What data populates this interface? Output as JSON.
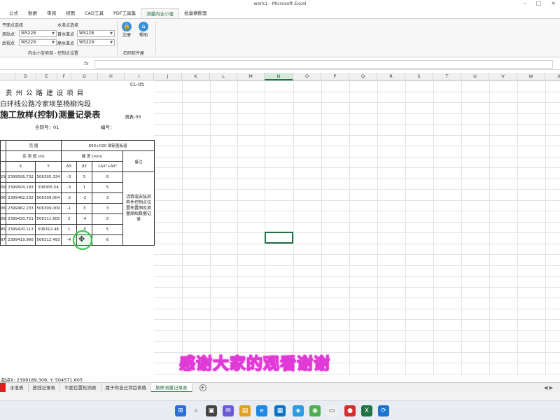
{
  "window": {
    "title": "work1 - Microsoft Excel"
  },
  "ribbon": {
    "tabs": [
      "公式",
      "数据",
      "审阅",
      "视图",
      "CAD工具",
      "PDF工具集",
      "测量内业小宝",
      "批量横断面"
    ],
    "active_tab": "测量内业小宝",
    "plane_group_title": "平面点选择",
    "level_group_title": "水准点选择",
    "station_label": "测站点",
    "station_value": "WS228",
    "backsight_label": "后视点",
    "backsight_value": "WS229",
    "bm_start_label": "首水准点",
    "bm_start_value": "WS228",
    "bm_end_label": "尾水准点",
    "bm_end_value": "WS229",
    "group1_footer": "内业小宝项目 - 控制点设置",
    "register_label": "注册",
    "help_label": "帮助",
    "group2_footer": "石码软件屋"
  },
  "columns": [
    "D",
    "E",
    "F",
    "G",
    "H",
    "I",
    "J",
    "K",
    "L",
    "M",
    "N",
    "O",
    "P",
    "Q",
    "R",
    "S",
    "T",
    "U",
    "V",
    "W",
    "X"
  ],
  "selected_column": "N",
  "sheet": {
    "code": "CL-05",
    "header1": "贵 州 公 路 建 设 项 目",
    "header2": "白环线公路冷家坝至杨柳沟段",
    "header3": "施工放样(控制)测量记录表",
    "form_no": "测表-05",
    "contract_label": "合同号：01",
    "number_label": "编号：",
    "range_label": "范 围",
    "range_value": "K93+020 钢筋盖板涵",
    "measured_label": "实 测 值 (m)",
    "deviation_label": "偏 差 (mm)",
    "remark_label": "备注",
    "col_x": "X",
    "col_y": "Y",
    "col_dx": "ΔX",
    "col_dy": "ΔY",
    "col_formula": "√ΔX²+ΔY²",
    "remark_text": "浇筑或安装后构件控制点位置布置图及测量原始数据记录",
    "rows": [
      {
        "id": "29",
        "x": "2399506.732",
        "y": "506305.334",
        "dx": "-3",
        "dy": "5",
        "d": "6"
      },
      {
        "id": "09",
        "x": "2399504.193",
        "y": "506305.54",
        "dx": "-3",
        "dy": "1",
        "d": "5"
      },
      {
        "id": "06",
        "x": "2399462.232",
        "y": "506309.004",
        "dx": "-2",
        "dy": "-2",
        "d": "3"
      },
      {
        "id": "06",
        "x": "2399462.233",
        "y": "506309.009",
        "dx": "-1",
        "dy": "3",
        "d": "3"
      },
      {
        "id": "09",
        "x": "2399430.721",
        "y": "506311.605",
        "dx": "3",
        "dy": "-4",
        "d": "5"
      },
      {
        "id": "85",
        "x": "2399420.113",
        "y": "506312.48",
        "dx": "1",
        "dy": "-5",
        "d": "5"
      },
      {
        "id": "97",
        "x": "2399419.966",
        "y": "506312.493",
        "dx": "-4",
        "dy": "",
        "d": "6"
      }
    ]
  },
  "caption": "感谢大家的观看谢谢",
  "status_text": "起点X: 2399189.308;  Y: 504571.605",
  "sheet_tabs": [
    "水准表",
    "放线记录表",
    "平面位置检测表",
    "属于你自己项目表格",
    "放样测量记录表"
  ],
  "active_sheet": "放样测量记录表"
}
